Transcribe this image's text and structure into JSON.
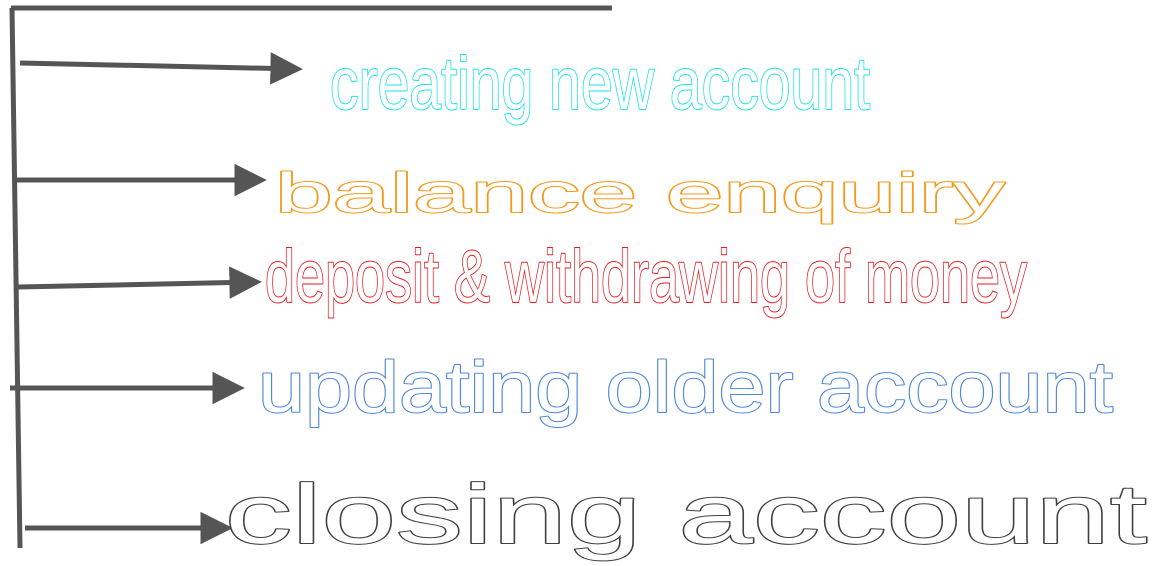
{
  "diagram": {
    "connector_color": "#555555",
    "items": [
      {
        "label": "creating new account",
        "color": "#19e3ea"
      },
      {
        "label": "balance enquiry",
        "color": "#f39a1c"
      },
      {
        "label": "deposit & withdrawing of money",
        "color": "#e4191c"
      },
      {
        "label": "updating older account",
        "color": "#4f87dd"
      },
      {
        "label": "closing account",
        "color": "#3f3f3f"
      }
    ]
  }
}
